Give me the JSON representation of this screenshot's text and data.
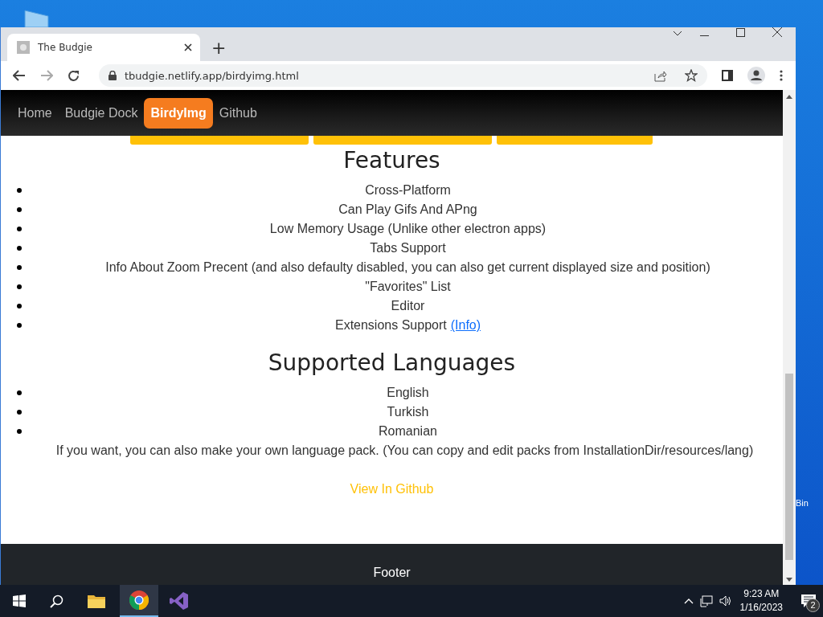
{
  "browser": {
    "tab": {
      "title": "The Budgie",
      "selected": true
    },
    "new_tab": "+",
    "address": "tbudgie.netlify.app/birdyimg.html"
  },
  "nav": [
    {
      "label": "Home",
      "selected": false
    },
    {
      "label": "Budgie Dock",
      "selected": false
    },
    {
      "label": "BirdyImg",
      "selected": true
    },
    {
      "label": "Github",
      "selected": false
    }
  ],
  "sections": [
    {
      "heading": "Features",
      "items": [
        {
          "text": "Cross-Platform"
        },
        {
          "text": "Can Play Gifs And APng"
        },
        {
          "text": "Low Memory Usage (Unlike other electron apps)"
        },
        {
          "text": "Tabs Support"
        },
        {
          "text": "Info About Zoom Precent (and also defaulty disabled, you can also get current displayed size and position)"
        },
        {
          "text": "\"Favorites\" List"
        },
        {
          "text": "Editor"
        },
        {
          "text": "Extensions Support",
          "link": "(Info)"
        }
      ]
    },
    {
      "heading": "Supported Languages",
      "items": [
        {
          "text": "English"
        },
        {
          "text": "Turkish"
        },
        {
          "text": "Romanian"
        }
      ],
      "note": "If you want, you can also make your own language pack. (You can copy and edit packs from InstallationDir/resources/lang)"
    }
  ],
  "github_link": "View In Github",
  "footer": "Footer",
  "desktop": {
    "icon_label": "Bin"
  },
  "taskbar": {
    "time": "9:23 AM",
    "date": "1/16/2023",
    "notifications": "2"
  }
}
